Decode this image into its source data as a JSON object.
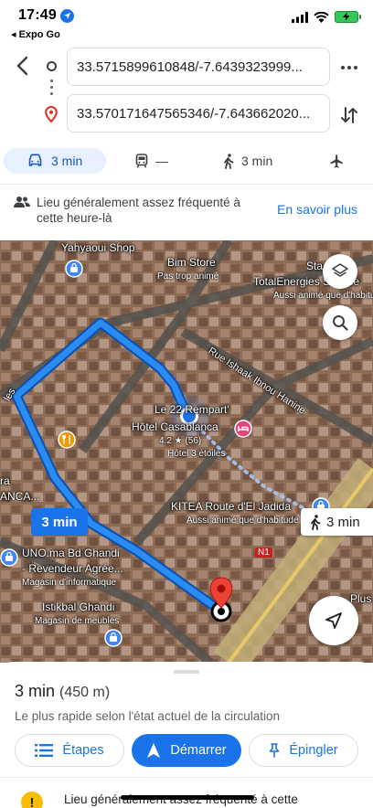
{
  "status_bar": {
    "time": "17:49",
    "back_app": "◂ Expo Go"
  },
  "route": {
    "origin_value": "33.5715899610848/-7.6439323999...",
    "destination_value": "33.570171647565346/-7.643662020..."
  },
  "modes": [
    {
      "icon": "car-icon",
      "label": "3 min",
      "active": true
    },
    {
      "icon": "transit-icon",
      "label": "—",
      "active": false
    },
    {
      "icon": "walk-icon",
      "label": "3 min",
      "active": false
    },
    {
      "icon": "flight-icon",
      "label": "",
      "active": false
    }
  ],
  "info_banner": {
    "text": "Lieu généralement assez fréquenté à cette heure-là",
    "link": "En savoir plus"
  },
  "map": {
    "labels": {
      "yahyaoui": "Yahyaoui Shop",
      "bim_store": "Bim Store",
      "bim_sub": "Pas trop animé",
      "sta": "Sta",
      "total": "TotalEnergies Service",
      "total_sub": "Aussi animé que d'habitude",
      "street": "Rue Ishaak Ibnou Hanine",
      "hotel_name": "Le 22 Rempart'",
      "hotel_name2": "Hôtel Casablanca",
      "hotel_rating": "4.2 ★ (56)",
      "hotel_sub": "Hôtel 3 étoiles",
      "kitea": "KITEA Route d'El Jadida",
      "kitea_sub": "Aussi animé que d'habitude",
      "les": "les",
      "ra": "ra",
      "anca": "ANCA...",
      "uno1": "UNO.ma Bd Ghandi",
      "uno2": "- Revendeur Agrée...",
      "uno_sub": "Magasin d'informatique",
      "istikbal": "Istikbal Ghandi",
      "istikbal_sub": "Magasin de meubles",
      "plus": "Plus",
      "n1": "N1"
    },
    "drive_time": "3 min",
    "walk_time": "3 min"
  },
  "sheet": {
    "time": "3 min",
    "distance": "(450 m)",
    "subtitle": "Le plus rapide selon l'état actuel de la circulation",
    "steps_label": "Étapes",
    "start_label": "Démarrer",
    "pin_label": "Épingler",
    "warning_text": "Lieu généralement assez fréquenté à cette"
  },
  "colors": {
    "accent": "#1a73e8",
    "route": "#2a8cf0",
    "warning": "#fbbc04"
  }
}
